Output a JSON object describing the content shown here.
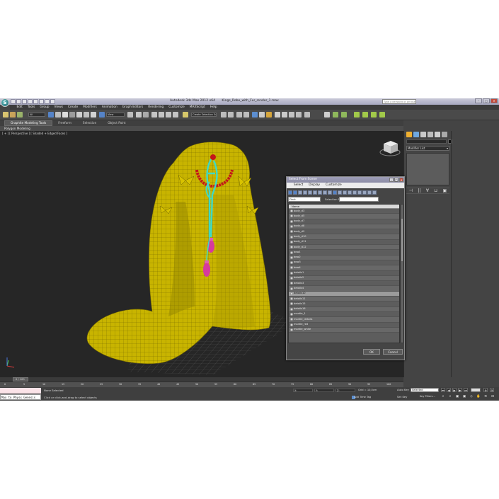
{
  "app": {
    "title": "Autodesk 3ds Max 2012 x64",
    "file": "Kings_Robe_with_Fur_render_1.max",
    "search_placeholder": "Type a keyword or phrase",
    "logo": "S"
  },
  "menu": [
    "Edit",
    "Tools",
    "Group",
    "Views",
    "Create",
    "Modifiers",
    "Animation",
    "Graph Editors",
    "Rendering",
    "Customize",
    "MAXScript",
    "Help"
  ],
  "toolbar": {
    "filter_dropdown": "All",
    "coord_dropdown": "View",
    "named_selection": "Create Selection Se"
  },
  "ribbon": {
    "tabs": [
      "Graphite Modeling Tools",
      "Freeform",
      "Selection",
      "Object Paint"
    ],
    "active_tab": "Graphite Modeling Tools",
    "sub_label": "Polygon Modeling"
  },
  "viewport": {
    "label": "[ + ] [ Perspective ] [ Shaded + Edged Faces ]"
  },
  "command_panel": {
    "modifier_list": "Modifier List",
    "stack_buttons": [
      "⊣",
      "||",
      "∀",
      "⊔",
      "▣"
    ]
  },
  "timeline": {
    "frame_label": "0 / 100",
    "ticks": [
      "0",
      "5",
      "10",
      "15",
      "20",
      "25",
      "30",
      "35",
      "40",
      "45",
      "50",
      "55",
      "60",
      "65",
      "70",
      "75",
      "80",
      "85",
      "90",
      "95",
      "100"
    ]
  },
  "status": {
    "listener_text": "Max to Physx Genesis",
    "selection": "None Selected",
    "prompt": "Click or click-and-drag to select objects",
    "x_label": "X:",
    "y_label": "Y:",
    "z_label": "Z:",
    "grid": "Grid = 10,0cm",
    "add_time_tag": "Add Time Tag",
    "auto_key": "Auto Key",
    "selected": "Selected",
    "set_key": "Set Key",
    "key_filters": "Key Filters..."
  },
  "dialog": {
    "title": "Select From Scene",
    "menu": [
      "Select",
      "Display",
      "Customize"
    ],
    "find_label": "Find:",
    "selection_set_label": "Selection Set:",
    "column_header": "Name",
    "items": [
      "body_d3",
      "body_d5",
      "body_d7",
      "body_d8",
      "body_d9",
      "body_d10",
      "body_d11",
      "body_d12",
      "bow1",
      "bow2",
      "bow3",
      "bow4",
      "details1",
      "details2",
      "details3",
      "details4",
      "details10",
      "details11",
      "details15",
      "details16",
      "mantle_1",
      "mantle_details",
      "mantle_red",
      "mantle_white"
    ],
    "selected_item": "details10",
    "ok_label": "OK",
    "cancel_label": "Cancel"
  },
  "colors": {
    "robe": "#c8b400",
    "cord": "#3fd9c4",
    "tassel": "#d63a9e",
    "beads": "#c41818",
    "titlebar": "#a9aac3",
    "selected_button": "#5583c7"
  }
}
